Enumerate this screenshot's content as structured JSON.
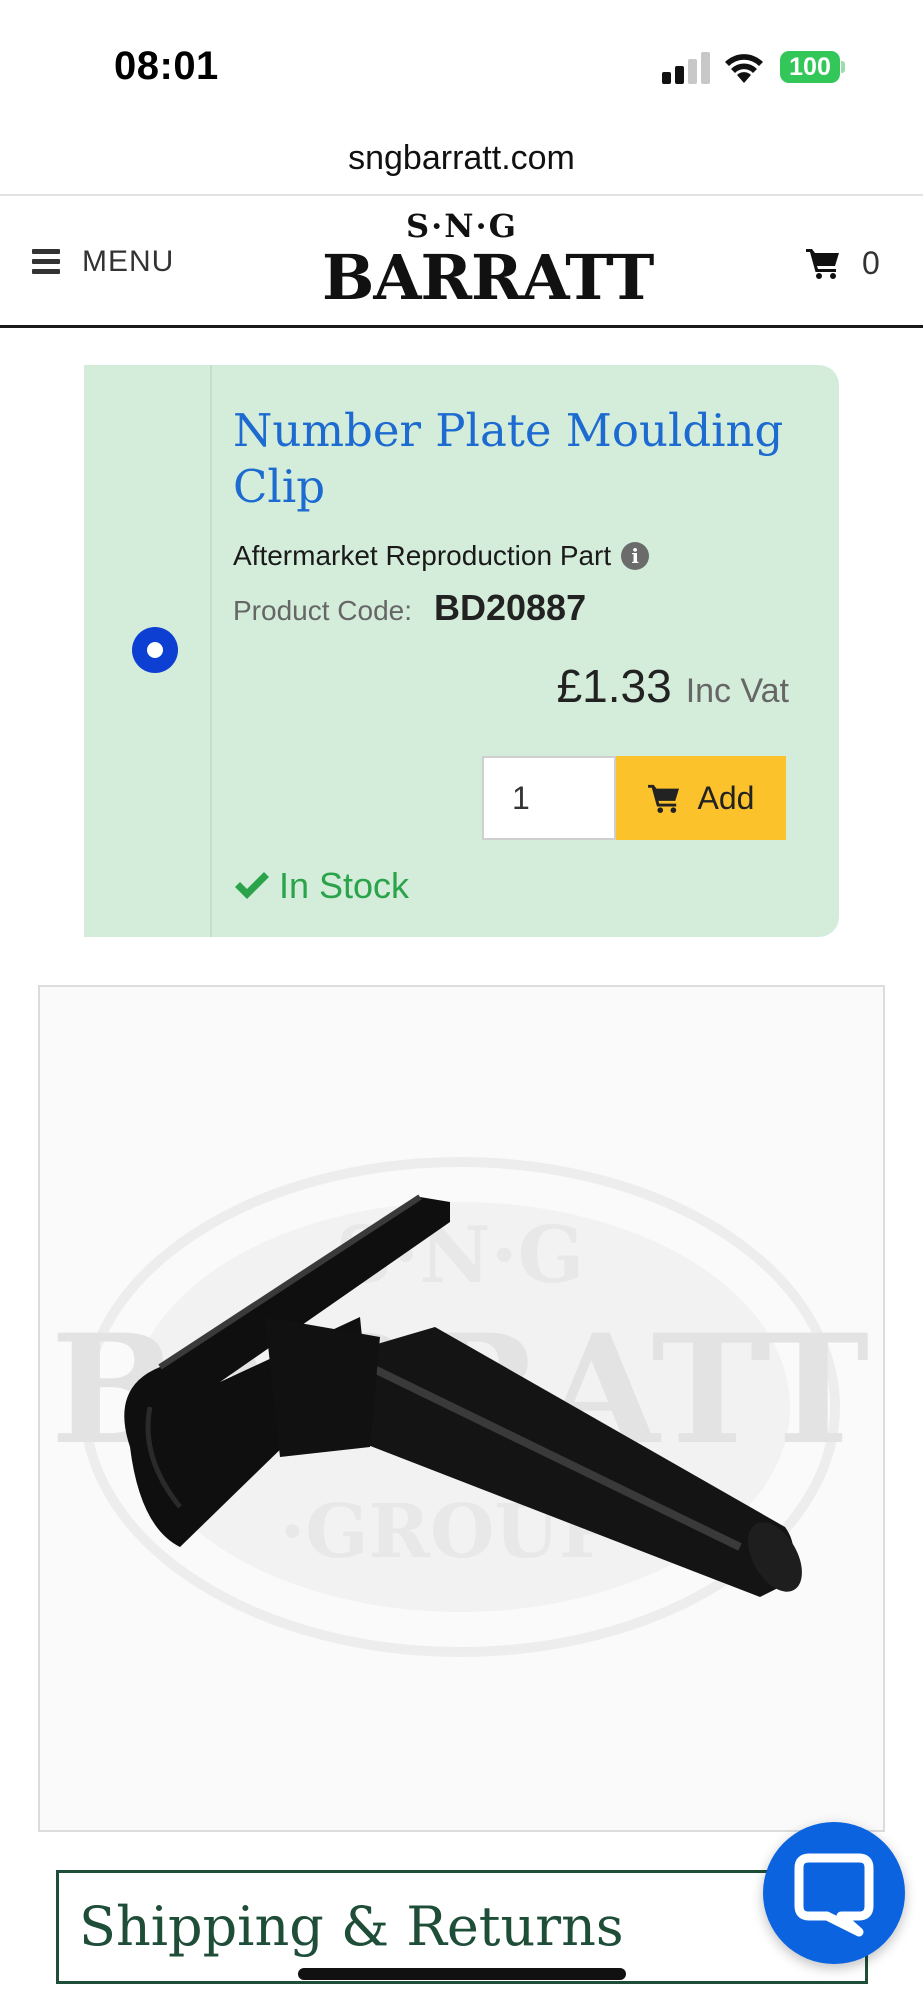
{
  "status_bar": {
    "time": "08:01",
    "battery": "100",
    "icons": [
      "signal-icon",
      "wifi-icon",
      "battery-icon"
    ]
  },
  "browser": {
    "url": "sngbarratt.com"
  },
  "header": {
    "menu_label": "MENU",
    "logo_top": "S·N·G",
    "logo_main": "BARRATT",
    "cart_count": "0",
    "icons": [
      "hamburger-icon",
      "cart-icon"
    ]
  },
  "product": {
    "title": "Number Plate Moulding Clip",
    "part_type": "Aftermarket Reproduction Part",
    "code_label": "Product Code:",
    "code": "BD20887",
    "price": "£1.33",
    "vat_label": "Inc Vat",
    "quantity": "1",
    "add_label": "Add",
    "stock_status": "In Stock",
    "selected": true
  },
  "image": {
    "alt": "Number Plate Moulding Clip",
    "watermark_top": "S·N·G",
    "watermark_main": "BARRATT",
    "watermark_bottom": "·GROUP·"
  },
  "shipping": {
    "title": "Shipping & Returns"
  },
  "colors": {
    "card_bg": "#d4eddb",
    "title_blue": "#1d6bd0",
    "add_yellow": "#fcc22c",
    "stock_green": "#2aa34a",
    "radio_blue": "#0d3fd3",
    "shipping_green": "#1e4d38",
    "chat_blue": "#0b63e0"
  }
}
